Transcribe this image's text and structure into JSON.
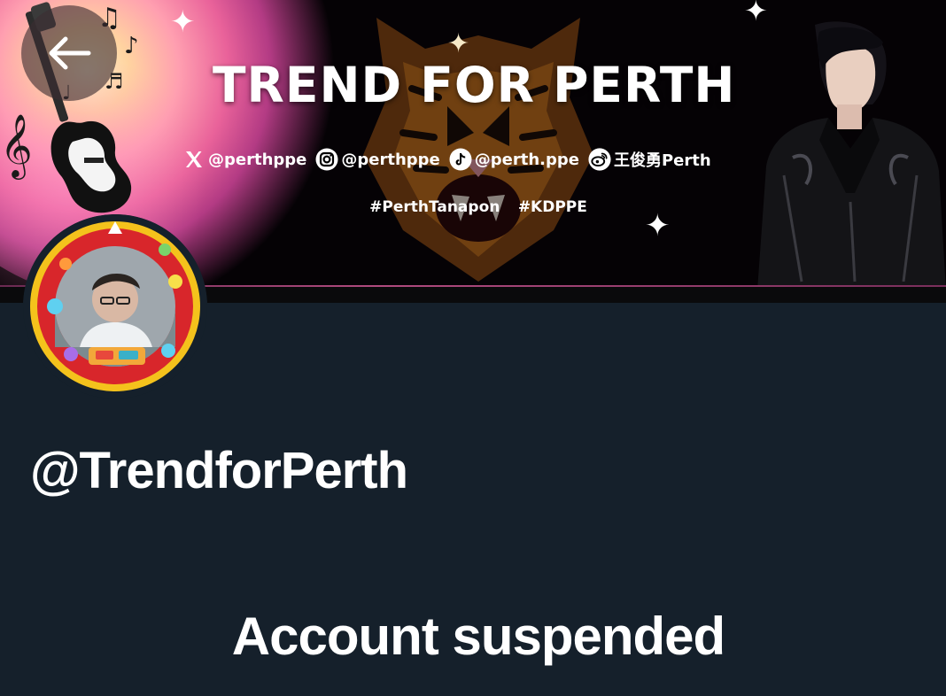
{
  "banner": {
    "title": "TREND FOR PERTH",
    "socials": [
      {
        "icon": "x-logo-icon",
        "handle": "@perthppe"
      },
      {
        "icon": "instagram-icon",
        "handle": "@perthppe"
      },
      {
        "icon": "tiktok-icon",
        "handle": "@perth.ppe"
      },
      {
        "icon": "weibo-icon",
        "handle": "王俊勇Perth"
      }
    ],
    "hashtags": [
      "#PerthTanapon",
      "#KDPPE"
    ]
  },
  "nav": {
    "back_icon": "arrow-left-icon"
  },
  "profile": {
    "handle": "@TrendforPerth",
    "status_message": "Account suspended"
  },
  "colors": {
    "background": "#15202b",
    "text": "#ffffff",
    "banner_background": "#050205",
    "avatar_ring": "#d8262b",
    "avatar_ring_outer": "#f4c21c"
  }
}
